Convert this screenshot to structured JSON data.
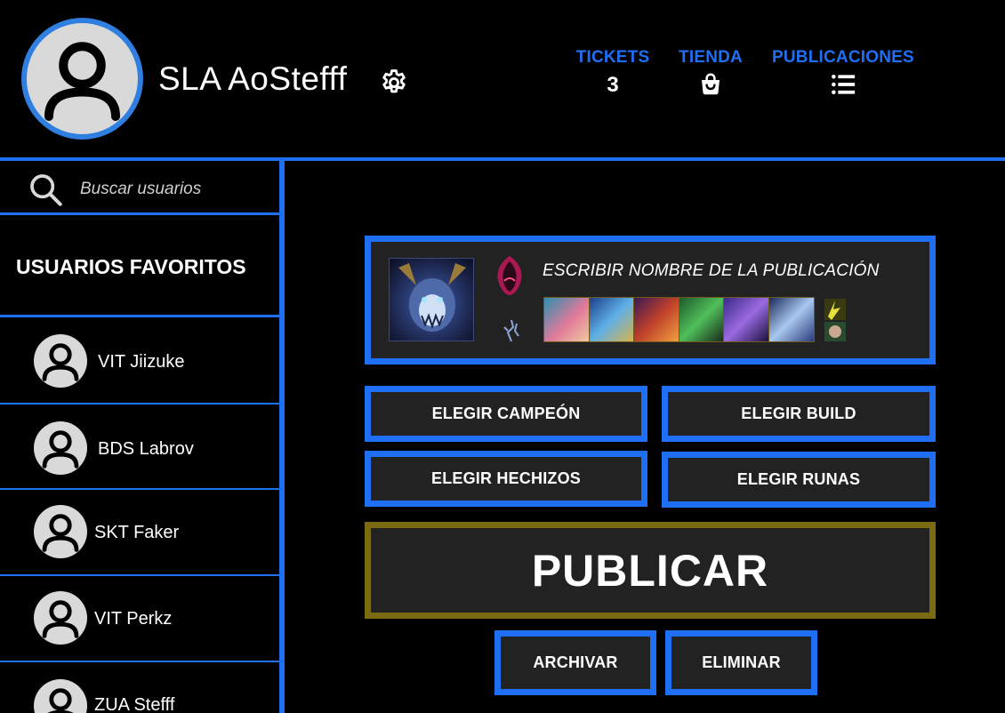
{
  "header": {
    "username": "SLA AoStefff",
    "stats": {
      "tickets": {
        "label": "TICKETS",
        "value": "3"
      },
      "tienda": {
        "label": "TIENDA",
        "icon": "shopping-bag-icon"
      },
      "publicaciones": {
        "label": "PUBLICACIONES",
        "icon": "list-icon"
      }
    }
  },
  "sidebar": {
    "search": {
      "placeholder": "Buscar usuarios",
      "icon": "search-icon"
    },
    "favorites_title": "USUARIOS FAVORITOS",
    "users": [
      {
        "name": "VIT Jiizuke"
      },
      {
        "name": "BDS Labrov"
      },
      {
        "name": "SKT Faker"
      },
      {
        "name": "VIT Perkz"
      },
      {
        "name": "ZUA Stefff"
      }
    ]
  },
  "publication": {
    "title_placeholder": "ESCRIBIR NOMBRE DE LA PUBLICACIÓN"
  },
  "actions": {
    "choose_champion": "ELEGIR CAMPEÓN",
    "choose_build": "ELEGIR BUILD",
    "choose_spells": "ELEGIR HECHIZOS",
    "choose_runes": "ELEGIR RUNAS",
    "publish": "PUBLICAR",
    "archive": "ARCHIVAR",
    "delete": "ELIMINAR"
  },
  "colors": {
    "accent_blue": "#1f6ff5",
    "publish_border": "#7a6a12",
    "panel_bg": "#222222",
    "page_bg": "#000000"
  }
}
